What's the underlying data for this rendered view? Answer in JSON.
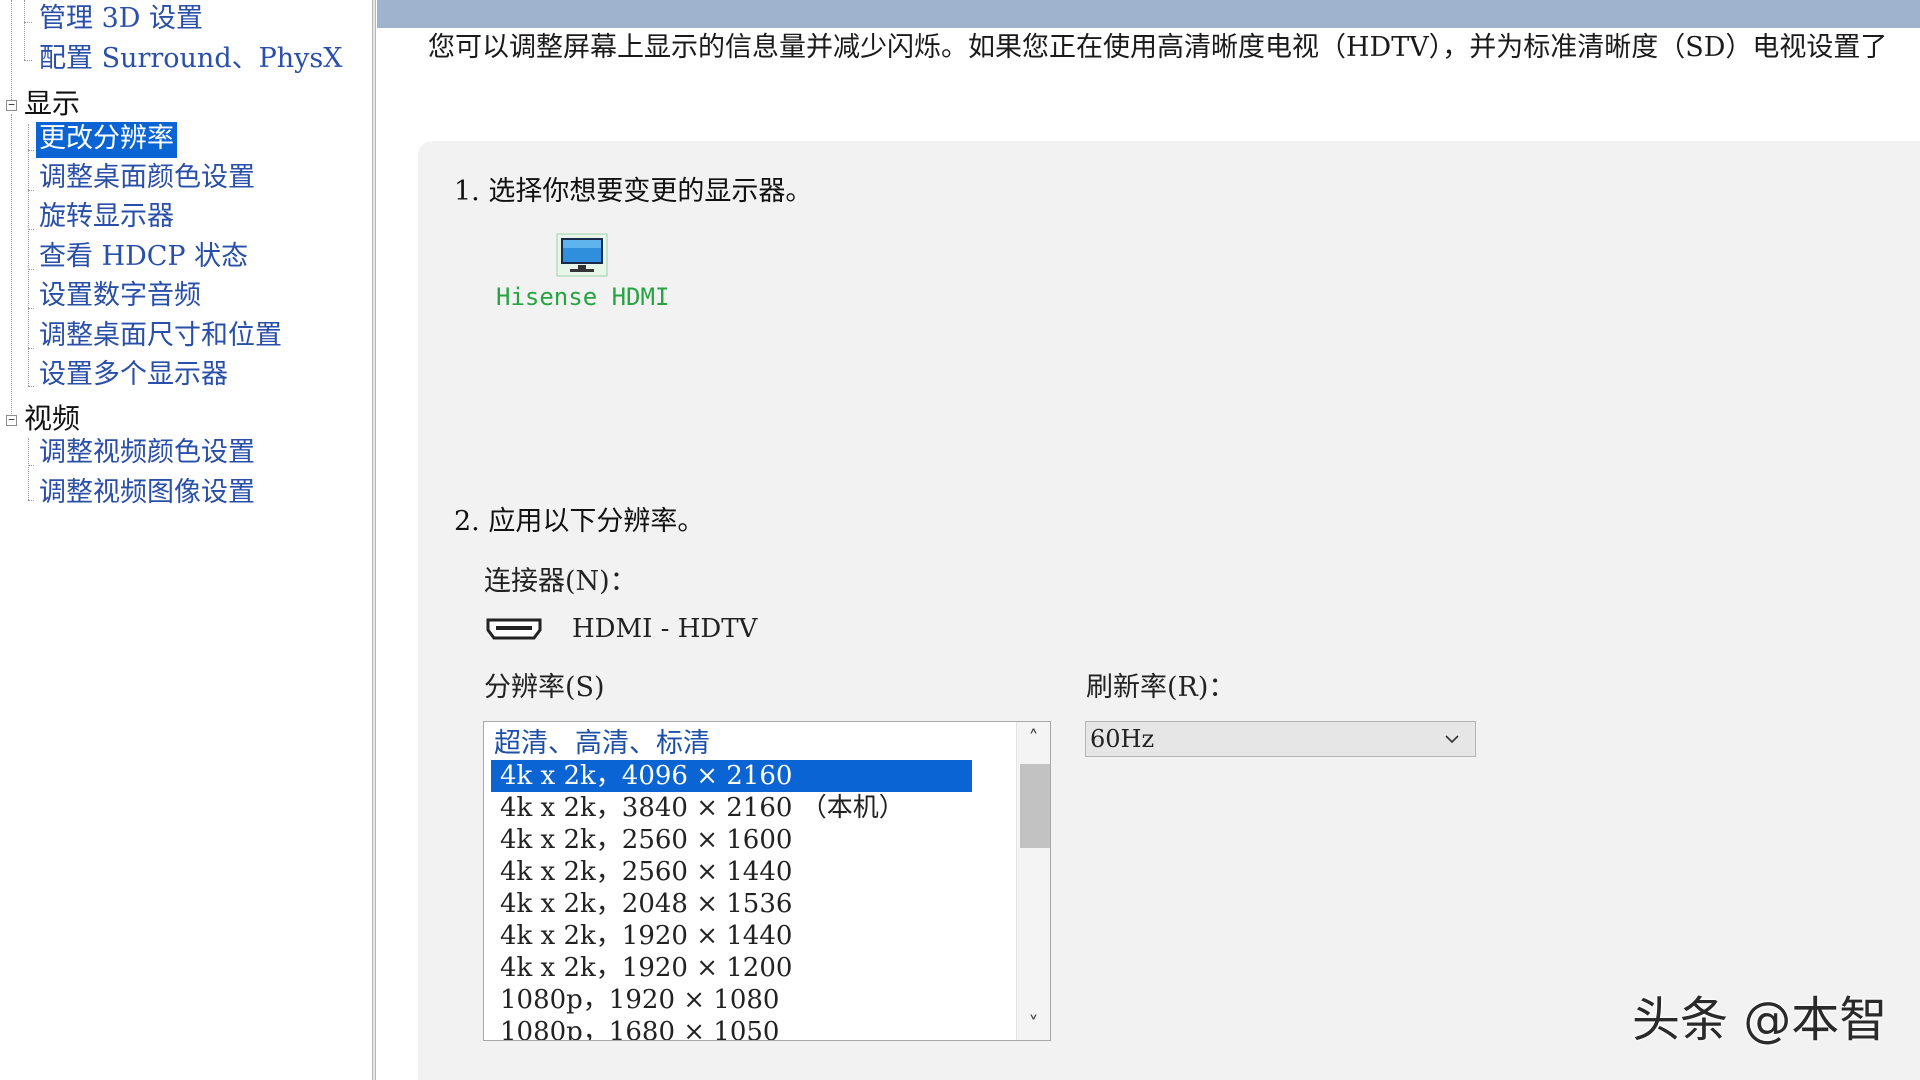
{
  "sidebar": {
    "items_top": [
      {
        "label": "管理 3D 设置"
      },
      {
        "label": "配置 Surround、PhysX"
      }
    ],
    "groups": [
      {
        "label": "显示",
        "expander": "−",
        "items": [
          {
            "label": "更改分辨率",
            "selected": true
          },
          {
            "label": "调整桌面颜色设置"
          },
          {
            "label": "旋转显示器"
          },
          {
            "label": "查看 HDCP 状态"
          },
          {
            "label": "设置数字音频"
          },
          {
            "label": "调整桌面尺寸和位置"
          },
          {
            "label": "设置多个显示器"
          }
        ]
      },
      {
        "label": "视频",
        "expander": "−",
        "items": [
          {
            "label": "调整视频颜色设置"
          },
          {
            "label": "调整视频图像设置"
          }
        ]
      }
    ]
  },
  "main": {
    "description": "您可以调整屏幕上显示的信息量并减少闪烁。如果您正在使用高清晰度电视（HDTV），并为标准清晰度（SD）电视设置了",
    "step1": {
      "title": "1.  选择你想要变更的显示器。",
      "display_name": "Hisense HDMI",
      "icon": "monitor-icon"
    },
    "step2": {
      "title": "2.  应用以下分辨率。",
      "connector_label": "连接器(N)：",
      "connector_icon": "hdmi-port-icon",
      "connector_value": "HDMI - HDTV",
      "resolution_label": "分辨率(S)",
      "refresh_label": "刷新率(R)：",
      "resolution_group": "超清、高清、标清",
      "resolutions": [
        {
          "text": "4k x 2k，4096 × 2160",
          "selected": true
        },
        {
          "text": "4k x 2k，3840 × 2160 （本机）"
        },
        {
          "text": "4k x 2k，2560 × 1600"
        },
        {
          "text": "4k x 2k，2560 × 1440"
        },
        {
          "text": "4k x 2k，2048 × 1536"
        },
        {
          "text": "4k x 2k，1920 × 1440"
        },
        {
          "text": "4k x 2k，1920 × 1200"
        },
        {
          "text": "1080p，1920 × 1080"
        },
        {
          "text": "1080p，1680 × 1050"
        }
      ],
      "refresh_value": "60Hz"
    }
  },
  "watermark": "头条 @本智",
  "colors": {
    "selection": "#0a64d4",
    "link": "#2a4fa8",
    "display_label": "#27a342",
    "header_band": "#9fb3cf",
    "panel_bg": "#f2f2f2"
  }
}
